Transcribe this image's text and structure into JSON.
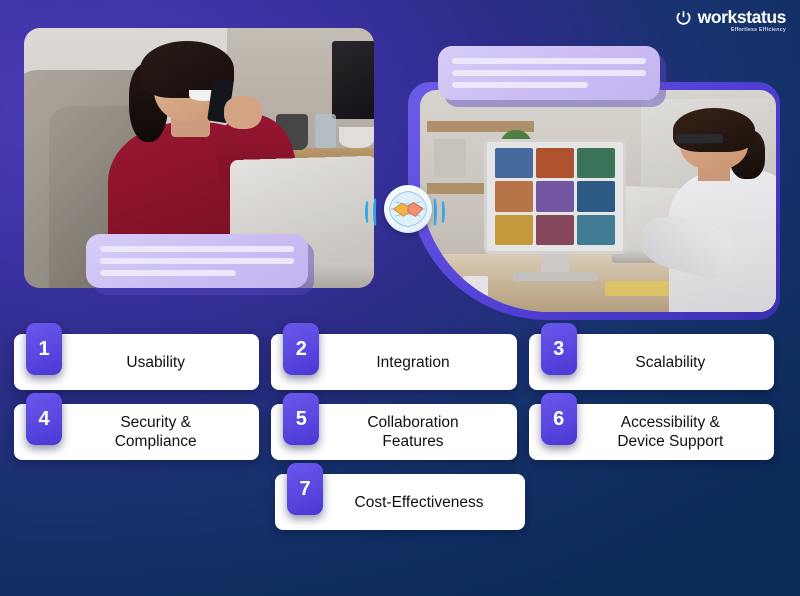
{
  "brand": {
    "logo_icon": "clock-power-icon",
    "name": "workstatus",
    "tagline": "Effortless Efficiency"
  },
  "colors": {
    "background_start": "#4134ad",
    "background_end": "#072548",
    "badge_purple": "#5947e0",
    "bubble_purple": "#cbbdf3",
    "card_white": "#ffffff",
    "card_text": "#101018",
    "wave_blue": "#2da7e8"
  },
  "media": {
    "photo_left": {
      "name": "woman-on-phone-with-laptop",
      "alt": "Smiling woman in red sweater talking on a mobile phone while using a laptop in a kitchen"
    },
    "photo_right": {
      "name": "woman-in-video-conference",
      "alt": "Woman at a desk on a video conference call shown on a desktop monitor with a grid of participants"
    },
    "center_icon": {
      "name": "handshake-globe-icon",
      "glyph": "🤝"
    }
  },
  "bubbles": [
    {
      "name": "chat-bubble-top",
      "lines": 3
    },
    {
      "name": "chat-bubble-left",
      "lines": 3
    }
  ],
  "cards": {
    "rows": [
      [
        {
          "number": "1",
          "label": "Usability"
        },
        {
          "number": "2",
          "label": "Integration"
        },
        {
          "number": "3",
          "label": "Scalability"
        }
      ],
      [
        {
          "number": "4",
          "label": "Security &\nCompliance"
        },
        {
          "number": "5",
          "label": "Collaboration\nFeatures"
        },
        {
          "number": "6",
          "label": "Accessibility &\nDevice Support"
        }
      ],
      [
        {
          "number": "7",
          "label": "Cost-Effectiveness"
        }
      ]
    ]
  }
}
